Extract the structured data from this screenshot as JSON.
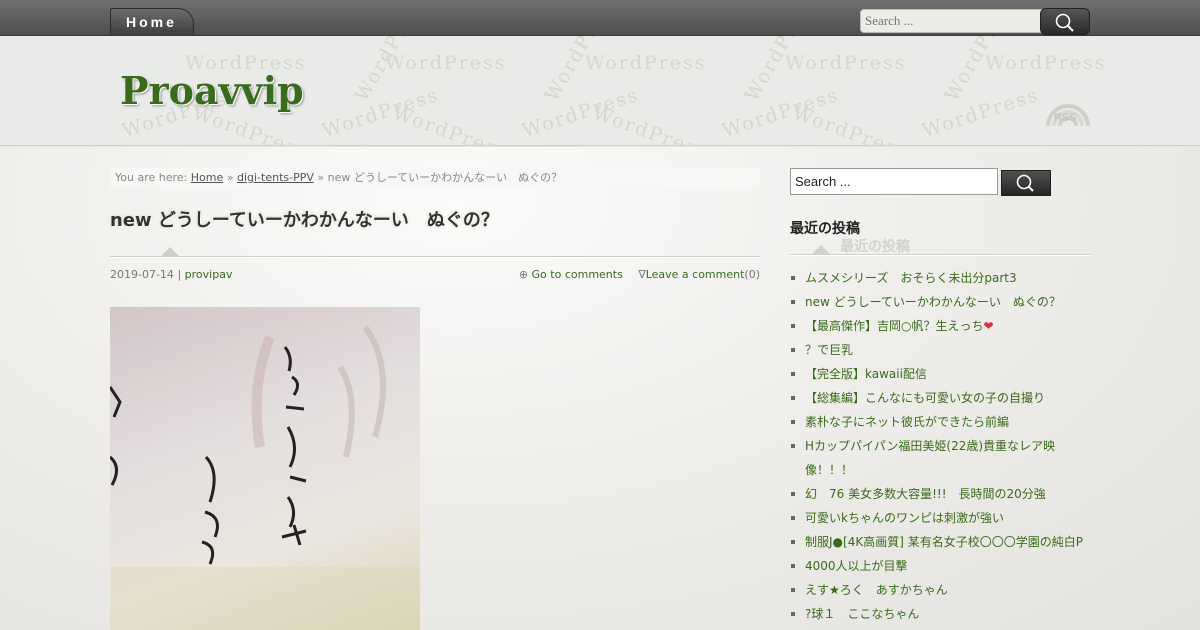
{
  "nav": {
    "home_label": "Home",
    "search_placeholder": "Search ..."
  },
  "header": {
    "site_title": "Proavvip",
    "watermark_text": "WordPress",
    "rss_label": "RSS"
  },
  "breadcrumb": {
    "prefix": "You are here:",
    "home": "Home",
    "sep1": "»",
    "category": "digi-tents-PPV",
    "sep2": "»",
    "current": "new どうしーていーかわかんなーい　ぬぐの？"
  },
  "post": {
    "title": "new どうしーていーかわかんなーい　ぬぐの？",
    "date": "2019-07-14",
    "meta_sep": "|",
    "author": "provipav",
    "comments_icon": "⊕",
    "goto_comments": "Go to comments",
    "leave_icon": "∇",
    "leave_comment": "Leave a comment",
    "comment_count": "(0)"
  },
  "sidebar": {
    "search_value": "Search ...",
    "recent_title": "最近の投稿",
    "recent_posts": [
      "ムスメシリーズ　おそらく未出分part3",
      "new どうしーていーかわかんなーい　ぬぐの？",
      "【最高傑作】吉岡○帆？生えっち",
      "？で巨乳",
      "【完全版】kawaii配信",
      "【総集編】こんなにも可愛い女の子の自撮り",
      "素朴な子にネット彼氏ができたら前編",
      "Hカップパイパン福田美姫(22歳)貴重なレア映像！！！",
      "幻　76 美女多数大容量!!!　長時間の20分強",
      "可愛いkちゃんのワンピは刺激が強い",
      "制服J●[4K高画質] 某有名女子校〇〇〇学園の純白P",
      "4000人以上が目撃",
      "えす★ろく　あすかちゃん",
      "?球１　ここなちゃん"
    ]
  },
  "colors": {
    "accent_green": "#3a6b1d",
    "heart_red": "#d9303a"
  }
}
